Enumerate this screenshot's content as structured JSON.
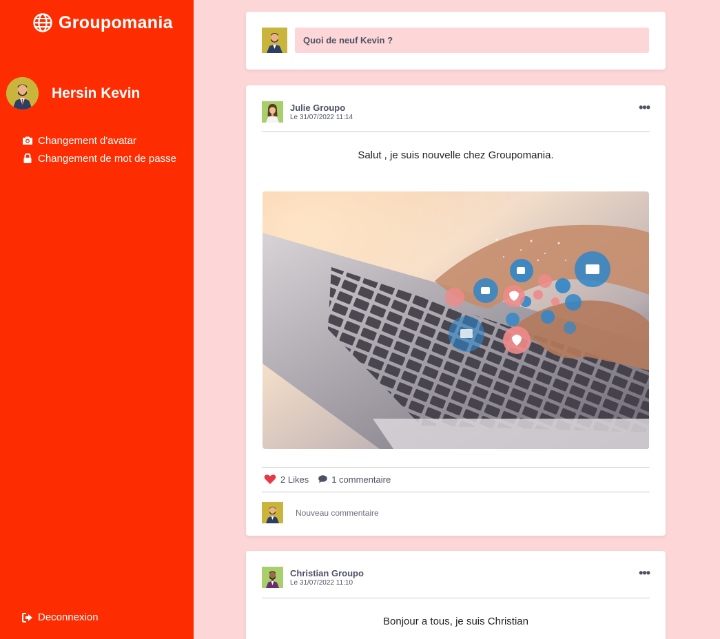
{
  "app": {
    "brand": "Groupomania"
  },
  "user": {
    "name": "Hersin Kevin"
  },
  "sidebar": {
    "items": [
      {
        "label": "Changement d'avatar",
        "icon": "camera-icon"
      },
      {
        "label": "Changement de mot de passe",
        "icon": "lock-icon"
      }
    ],
    "logout_label": "Deconnexion"
  },
  "composer": {
    "placeholder": "Quoi de neuf Kevin ?"
  },
  "posts": [
    {
      "author": "Julie Groupo",
      "date": "Le 31/07/2022 11:14",
      "text": "Salut , je suis nouvelle chez Groupomania.",
      "likes": "2 Likes",
      "comments": "1 commentaire",
      "comment_placeholder": "Nouveau commentaire",
      "more": "•••"
    },
    {
      "author": "Christian Groupo",
      "date": "Le 31/07/2022 11:10",
      "text": "Bonjour a tous, je suis Christian",
      "more": "•••"
    }
  ],
  "colors": {
    "primary": "#fd2d01",
    "secondary": "#fdd7d7",
    "tertiary": "#4e5166"
  }
}
